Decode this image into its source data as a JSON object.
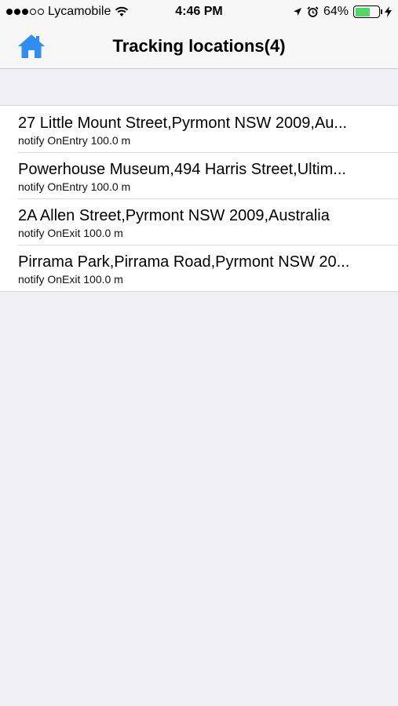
{
  "status_bar": {
    "carrier": "Lycamobile",
    "time": "4:46 PM",
    "battery_percent": "64%",
    "battery_level": 0.64,
    "signal_bars_filled": 3,
    "signal_bars_total": 5
  },
  "nav": {
    "title": "Tracking locations(4)",
    "home_icon": "home-icon",
    "accent_color": "#2f8ef0"
  },
  "locations": [
    {
      "title": "27 Little Mount Street,Pyrmont NSW 2009,Au...",
      "subtitle": "notify OnEntry 100.0 m"
    },
    {
      "title": "Powerhouse Museum,494 Harris Street,Ultim...",
      "subtitle": "notify OnEntry 100.0 m"
    },
    {
      "title": "2A Allen Street,Pyrmont NSW 2009,Australia",
      "subtitle": "notify OnExit 100.0 m"
    },
    {
      "title": "Pirrama Park,Pirrama Road,Pyrmont NSW 20...",
      "subtitle": "notify OnExit 100.0 m"
    }
  ]
}
